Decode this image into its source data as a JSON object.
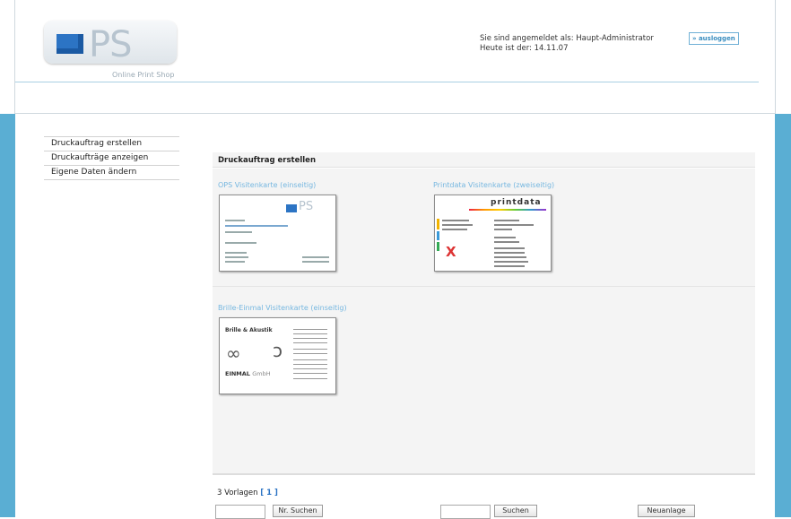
{
  "brand": {
    "tagline": "Online Print Shop",
    "logo_text": "PS",
    "colors": {
      "frame": "#5aaed3",
      "accent": "#76b7e0",
      "logo_blue": "#2c74c4"
    }
  },
  "header": {
    "login_label": "Sie sind angemeldet als: Haupt-Administrator",
    "date_label": "Heute ist der: 14.11.07",
    "logout_button": "» ausloggen"
  },
  "sidebar": {
    "items": [
      {
        "label": "Druckauftrag erstellen"
      },
      {
        "label": "Druckaufträge anzeigen"
      },
      {
        "label": "Eigene Daten ändern"
      }
    ]
  },
  "main": {
    "title": "Druckauftrag erstellen",
    "templates": [
      {
        "title": "OPS Visitenkarte (einseitig)"
      },
      {
        "title": "Printdata Visitenkarte (zweiseitig)"
      },
      {
        "title": "Brille-Einmal Visitenkarte (einseitig)"
      }
    ],
    "card_texts": {
      "ops_logo": "PS",
      "printdata_logo": "printdata",
      "brille_title": "Brille & Akustik",
      "einmal_name": "EINMAL",
      "einmal_suffix": "GmbH"
    }
  },
  "footer": {
    "count_label": "3 Vorlagen",
    "page_label": "[ 1 ]",
    "nr_search_button": "Nr. Suchen",
    "search_button": "Suchen",
    "new_button": "Neuanlage",
    "nr_search_value": "",
    "search_value": ""
  }
}
